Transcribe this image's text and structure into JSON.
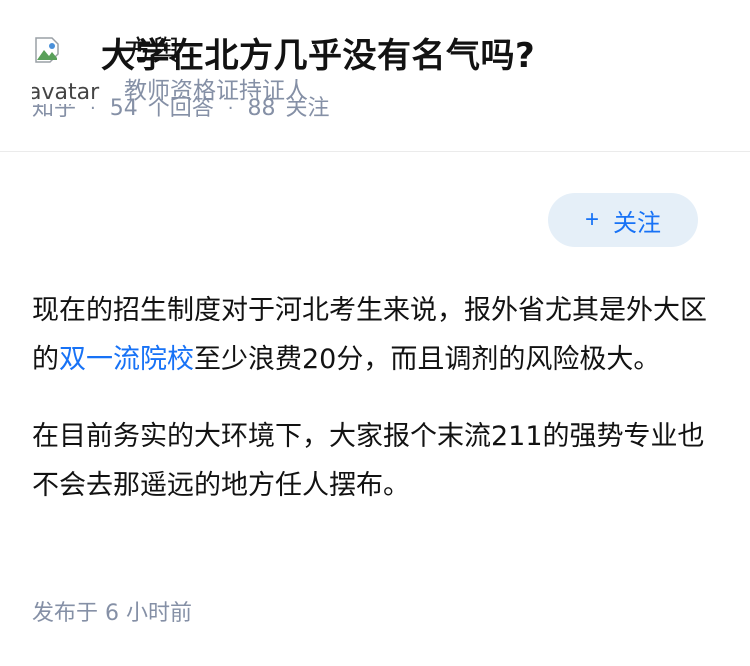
{
  "question": {
    "title": "中山大学在北方几乎没有名气吗?",
    "source": "知乎",
    "answer_count": "54",
    "answer_suffix": "个回答",
    "follower_count": "88",
    "follower_suffix": "关注"
  },
  "answer": {
    "author": {
      "name": "方舆",
      "headline": "教师资格证持证人",
      "avatar_alt": "avatar"
    },
    "follow_button": {
      "label": "关注"
    },
    "paragraphs": [
      {
        "before": "现在的招生制度对于河北考生来说，报外省尤其是外大区的",
        "link": "双一流院校",
        "after": "至少浪费20分，而且调剂的风险极大。"
      },
      {
        "text": "在目前务实的大环境下，大家报个末流211的强势专业也不会去那遥远的地方任人摆布。"
      }
    ],
    "published": "发布于  6 小时前"
  },
  "colors": {
    "meta_text": "#8590a6",
    "link": "#1772f6",
    "follow_bg": "#e5eff8"
  }
}
